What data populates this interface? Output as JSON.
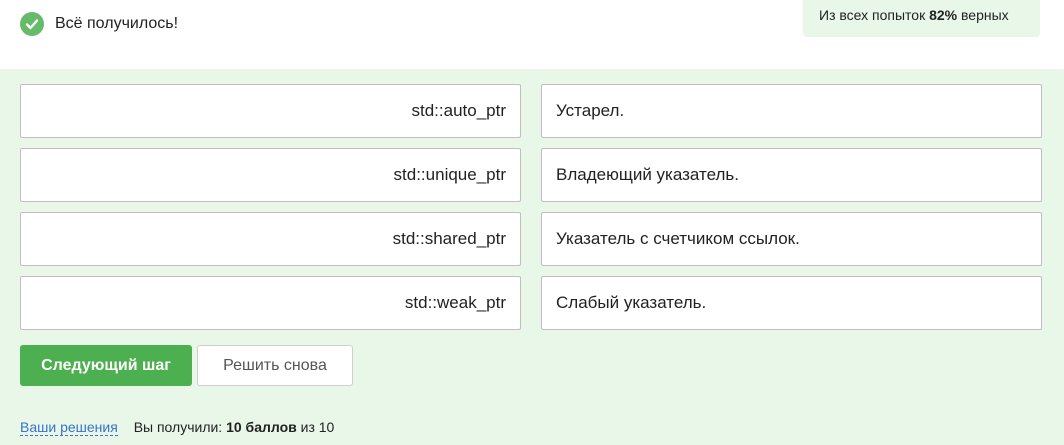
{
  "header": {
    "success_text": "Всё получилось!",
    "stats": {
      "prefix": "Из всех попыток",
      "percent": "82%",
      "suffix": "верных"
    }
  },
  "matching": {
    "rows": [
      {
        "term": "std::auto_ptr",
        "definition": "Устарел."
      },
      {
        "term": "std::unique_ptr",
        "definition": "Владеющий указатель."
      },
      {
        "term": "std::shared_ptr",
        "definition": "Указатель с счетчиком ссылок."
      },
      {
        "term": "std::weak_ptr",
        "definition": "Слабый указатель."
      }
    ]
  },
  "actions": {
    "next_label": "Следующий шаг",
    "retry_label": "Решить снова"
  },
  "footer": {
    "solutions_link": "Ваши решения",
    "score_prefix": "Вы получили:",
    "score_bold": "10 баллов",
    "score_suffix": "из 10"
  },
  "colors": {
    "accent": "#4caf50",
    "success_icon": "#66bb6a",
    "panel_background": "#e9f7e9",
    "link": "#3a72c7"
  }
}
